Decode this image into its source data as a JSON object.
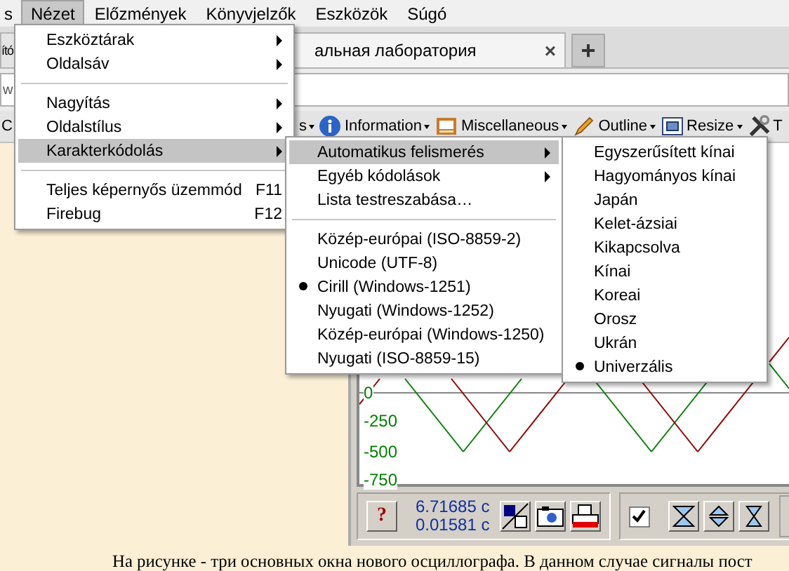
{
  "menu_bar": [
    {
      "label": "s",
      "selected": false
    },
    {
      "label": "Nézet",
      "selected": true
    },
    {
      "label": "Előzmények",
      "selected": false
    },
    {
      "label": "Könyvjelzők",
      "selected": false
    },
    {
      "label": "Eszközök",
      "selected": false
    },
    {
      "label": "Súgó",
      "selected": false
    }
  ],
  "tabs": [
    {
      "label": "ító",
      "selected": false
    },
    {
      "label": "альная лаборатория",
      "selected": true,
      "close": "×"
    }
  ],
  "new_tab": "+",
  "address_bar": {
    "value": "w"
  },
  "toolbar": [
    {
      "label": "C",
      "dropdown": false
    },
    {
      "label": "s",
      "dropdown": true
    },
    {
      "label": "Information",
      "dropdown": true
    },
    {
      "label": "Miscellaneous",
      "dropdown": true
    },
    {
      "label": "Outline",
      "dropdown": true
    },
    {
      "label": "Resize",
      "dropdown": true
    },
    {
      "label": "T",
      "dropdown": false
    }
  ],
  "view_menu": [
    {
      "kind": "submenu",
      "label": "Eszköztárak",
      "selected": false
    },
    {
      "kind": "submenu",
      "label": "Oldalsáv",
      "selected": false
    },
    {
      "kind": "separator"
    },
    {
      "kind": "submenu",
      "label": "Nagyítás",
      "selected": false
    },
    {
      "kind": "submenu",
      "label": "Oldalstílus",
      "selected": false
    },
    {
      "kind": "submenu",
      "label": "Karakterkódolás",
      "selected": true
    },
    {
      "kind": "separator"
    },
    {
      "kind": "item",
      "label": "Teljes képernyős üzemmód",
      "shortcut": "F11",
      "selected": false
    },
    {
      "kind": "item",
      "label": "Firebug",
      "shortcut": "F12",
      "selected": false
    }
  ],
  "encoding_menu": [
    {
      "kind": "submenu",
      "label": "Automatikus felismerés",
      "selected": true
    },
    {
      "kind": "submenu",
      "label": "Egyéb kódolások",
      "selected": false
    },
    {
      "kind": "item",
      "label": "Lista testreszabása…",
      "selected": false
    },
    {
      "kind": "separator"
    },
    {
      "kind": "radio",
      "label": "Közép-európai (ISO-8859-2)",
      "checked": false
    },
    {
      "kind": "radio",
      "label": "Unicode (UTF-8)",
      "checked": false
    },
    {
      "kind": "radio",
      "label": "Cirill (Windows-1251)",
      "checked": true
    },
    {
      "kind": "radio",
      "label": "Nyugati (Windows-1252)",
      "checked": false
    },
    {
      "kind": "radio",
      "label": "Közép-európai (Windows-1250)",
      "checked": false
    },
    {
      "kind": "radio",
      "label": "Nyugati (ISO-8859-15)",
      "checked": false
    }
  ],
  "auto_detect_menu": [
    {
      "kind": "radio",
      "label": "Egyszerűsített kínai",
      "checked": false
    },
    {
      "kind": "radio",
      "label": "Hagyományos kínai",
      "checked": false
    },
    {
      "kind": "radio",
      "label": "Japán",
      "checked": false
    },
    {
      "kind": "radio",
      "label": "Kelet-ázsiai",
      "checked": false
    },
    {
      "kind": "radio",
      "label": "Kikapcsolva",
      "checked": false
    },
    {
      "kind": "radio",
      "label": "Kínai",
      "checked": false
    },
    {
      "kind": "radio",
      "label": "Koreai",
      "checked": false
    },
    {
      "kind": "radio",
      "label": "Orosz",
      "checked": false
    },
    {
      "kind": "radio",
      "label": "Ukrán",
      "checked": false
    },
    {
      "kind": "radio",
      "label": "Univerzális",
      "checked": true
    }
  ],
  "oscillograph": {
    "y_labels": [
      "0",
      "-250",
      "-500",
      "-750"
    ],
    "help_button": "?",
    "readings": [
      "6.71685 c",
      "0.01581 c"
    ],
    "sync_checked": true
  },
  "caption": "На рисунке - три основных окна нового осциллографа. В данном случае сигналы пост"
}
